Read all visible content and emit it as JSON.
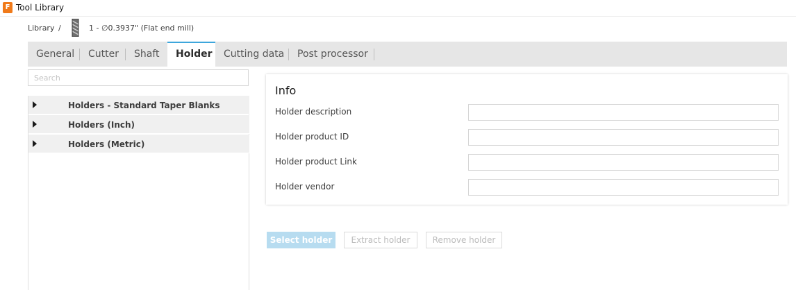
{
  "window": {
    "title": "Tool Library",
    "app_icon_letter": "F"
  },
  "breadcrumb": {
    "root": "Library",
    "separator": "/",
    "tool_icon": "flat-end-mill-icon",
    "tool_name": "1 - ∅0.3937\" (Flat end mill)"
  },
  "tabs": [
    {
      "label": "General",
      "active": false
    },
    {
      "label": "Cutter",
      "active": false
    },
    {
      "label": "Shaft",
      "active": false
    },
    {
      "label": "Holder",
      "active": true
    },
    {
      "label": "Cutting data",
      "active": false
    },
    {
      "label": "Post processor",
      "active": false
    }
  ],
  "search": {
    "placeholder": "Search",
    "value": ""
  },
  "tree": {
    "items": [
      {
        "label": "Holders - Standard Taper Blanks",
        "icon": "expand-arrow-icon"
      },
      {
        "label": "Holders (Inch)",
        "icon": "expand-arrow-icon"
      },
      {
        "label": "Holders (Metric)",
        "icon": "expand-arrow-icon"
      }
    ]
  },
  "info": {
    "title": "Info",
    "fields": [
      {
        "label": "Holder description",
        "value": ""
      },
      {
        "label": "Holder product ID",
        "value": ""
      },
      {
        "label": "Holder product Link",
        "value": ""
      },
      {
        "label": "Holder vendor",
        "value": ""
      }
    ]
  },
  "actions": {
    "select": "Select holder",
    "extract": "Extract holder",
    "remove": "Remove holder"
  },
  "colors": {
    "accent": "#3da6dc",
    "app_icon": "#f07a1a",
    "primary_button": "#b7dcf0",
    "tab_bar": "#e6e6e6"
  }
}
